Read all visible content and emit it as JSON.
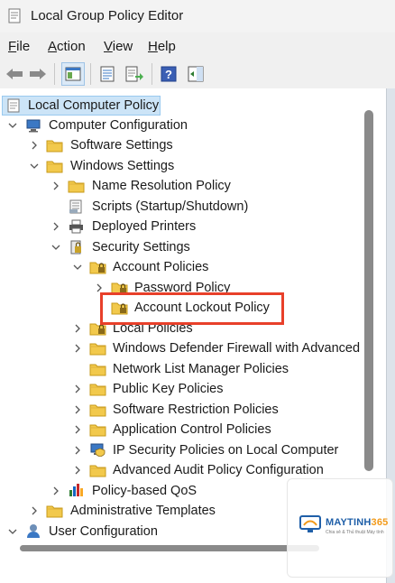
{
  "window": {
    "title": "Local Group Policy Editor"
  },
  "menu": [
    "File",
    "Action",
    "View",
    "Help"
  ],
  "toolbar": {
    "icons": [
      "back-arrow-icon",
      "forward-arrow-icon",
      "show-hide-tree-icon",
      "properties-icon",
      "export-list-icon",
      "help-icon",
      "show-action-pane-icon"
    ]
  },
  "tree": {
    "root": "Local Computer Policy",
    "computer_configuration": "Computer Configuration",
    "software_settings": "Software Settings",
    "windows_settings": "Windows Settings",
    "name_resolution_policy": "Name Resolution Policy",
    "scripts": "Scripts (Startup/Shutdown)",
    "deployed_printers": "Deployed Printers",
    "security_settings": "Security Settings",
    "account_policies": "Account Policies",
    "password_policy": "Password Policy",
    "account_lockout_policy": "Account Lockout Policy",
    "local_policies": "Local Policies",
    "windows_defender_firewall": "Windows Defender Firewall with Advanced",
    "network_list_manager": "Network List Manager Policies",
    "public_key_policies": "Public Key Policies",
    "software_restriction": "Software Restriction Policies",
    "application_control": "Application Control Policies",
    "ip_security": "IP Security Policies on Local Computer",
    "advanced_audit": "Advanced Audit Policy Configuration",
    "policy_based_qos": "Policy-based QoS",
    "administrative_templates": "Administrative Templates",
    "user_configuration": "User Configuration"
  },
  "watermark": {
    "brand_text": "MAYTINH",
    "brand_number": "365",
    "tagline": "Chia sẻ & Thủ thuật Máy tính"
  },
  "colors": {
    "selection": "#cce4f7",
    "highlight_box": "#e8402a",
    "folder": "#f2c94c",
    "watermark_blue": "#1f5fa8"
  }
}
